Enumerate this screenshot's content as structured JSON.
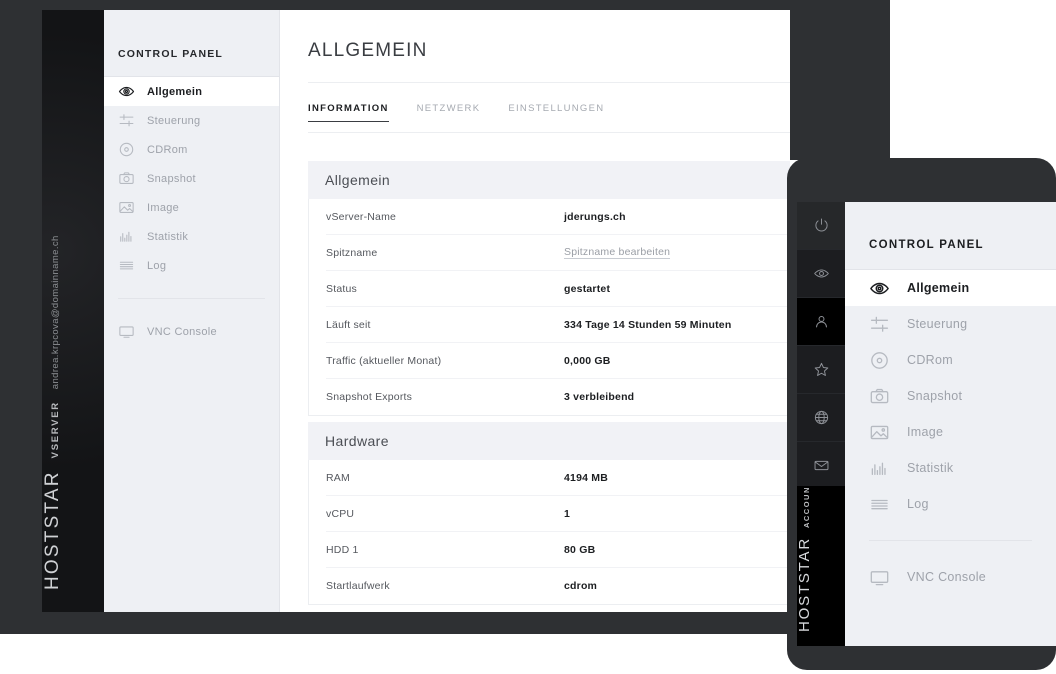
{
  "theme": {
    "backdrop": "#2e3033",
    "rail_black": "#141517",
    "nav_bg": "#eef0f4",
    "card_head_bg": "#f1f2f6",
    "accent_text": "#1c1e21",
    "muted_text": "#9ea2aa"
  },
  "desktop": {
    "brand_rail": {
      "brand": "HOSTSTAR",
      "product": "VSERVER",
      "account_email": "andrea.krpcova@domainname.ch"
    },
    "sidebar": {
      "header": "CONTROL PANEL",
      "items": [
        {
          "label": "Allgemein",
          "icon": "eye-icon",
          "active": true
        },
        {
          "label": "Steuerung",
          "icon": "sliders-icon",
          "active": false
        },
        {
          "label": "CDRom",
          "icon": "disc-icon",
          "active": false
        },
        {
          "label": "Snapshot",
          "icon": "camera-icon",
          "active": false
        },
        {
          "label": "Image",
          "icon": "image-icon",
          "active": false
        },
        {
          "label": "Statistik",
          "icon": "chart-icon",
          "active": false
        },
        {
          "label": "Log",
          "icon": "list-icon",
          "active": false
        }
      ],
      "footer_items": [
        {
          "label": "VNC Console",
          "icon": "monitor-icon",
          "active": false
        }
      ]
    },
    "main": {
      "page_title": "ALLGEMEIN",
      "tabs": [
        {
          "label": "INFORMATION",
          "active": true
        },
        {
          "label": "NETZWERK",
          "active": false
        },
        {
          "label": "EINSTELLUNGEN",
          "active": false
        }
      ],
      "cards": [
        {
          "title": "Allgemein",
          "rows": [
            {
              "key": "vServer-Name",
              "value": "jderungs.ch",
              "style": "bold"
            },
            {
              "key": "Spitzname",
              "value": "Spitzname bearbeiten",
              "style": "link"
            },
            {
              "key": "Status",
              "value": "gestartet",
              "style": "bold"
            },
            {
              "key": "Läuft seit",
              "value": "334 Tage 14 Stunden 59 Minuten",
              "style": "bold"
            },
            {
              "key": "Traffic (aktueller Monat)",
              "value": "0,000 GB",
              "style": "bold"
            },
            {
              "key": "Snapshot Exports",
              "value": "3 verbleibend",
              "style": "bold"
            }
          ]
        },
        {
          "title": "Hardware",
          "rows": [
            {
              "key": "RAM",
              "value": "4194 MB",
              "style": "bold"
            },
            {
              "key": "vCPU",
              "value": "1",
              "style": "bold"
            },
            {
              "key": "HDD 1",
              "value": "80 GB",
              "style": "bold"
            },
            {
              "key": "Startlaufwerk",
              "value": "cdrom",
              "style": "bold"
            }
          ]
        }
      ]
    }
  },
  "tablet": {
    "icon_rail": [
      {
        "icon": "power-icon",
        "selected": false
      },
      {
        "icon": "eye-icon",
        "selected": false
      },
      {
        "icon": "person-icon",
        "selected": true
      },
      {
        "icon": "star-icon",
        "selected": false
      },
      {
        "icon": "globe-icon",
        "selected": false
      },
      {
        "icon": "mail-icon",
        "selected": false
      },
      {
        "icon": "cloud-icon",
        "selected": false
      },
      {
        "icon": "server-icon",
        "selected": false
      }
    ],
    "brand_rail": {
      "brand": "HOSTSTAR",
      "product": "ACCOUNT"
    },
    "sidebar": {
      "header": "CONTROL PANEL",
      "items": [
        {
          "label": "Allgemein",
          "icon": "eye-icon",
          "active": true
        },
        {
          "label": "Steuerung",
          "icon": "sliders-icon",
          "active": false
        },
        {
          "label": "CDRom",
          "icon": "disc-icon",
          "active": false
        },
        {
          "label": "Snapshot",
          "icon": "camera-icon",
          "active": false
        },
        {
          "label": "Image",
          "icon": "image-icon",
          "active": false
        },
        {
          "label": "Statistik",
          "icon": "chart-icon",
          "active": false
        },
        {
          "label": "Log",
          "icon": "list-icon",
          "active": false
        }
      ],
      "footer_items": [
        {
          "label": "VNC Console",
          "icon": "monitor-icon",
          "active": false
        }
      ]
    }
  }
}
